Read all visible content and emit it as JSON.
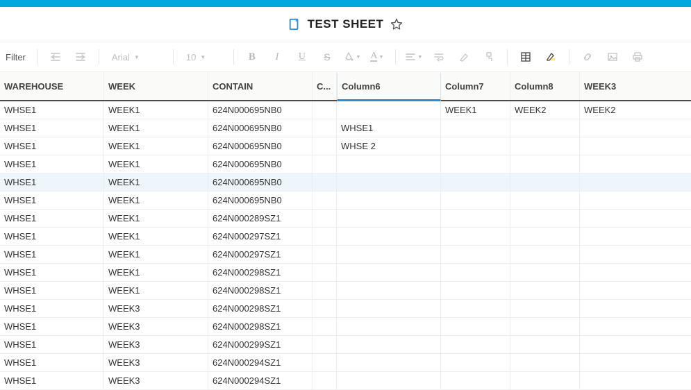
{
  "app": {
    "title": "TEST SHEET"
  },
  "toolbar": {
    "filter": "Filter",
    "font": "Arial",
    "font_size": "10"
  },
  "table": {
    "columns": [
      "WAREHOUSE",
      "WEEK",
      "CONTAIN",
      "C...",
      "Column6",
      "Column7",
      "Column8",
      "WEEK3"
    ],
    "selected_col_index": 4,
    "highlighted_row_index": 4,
    "rows": [
      [
        "WHSE1",
        "WEEK1",
        "624N000695NB0",
        "",
        "",
        "WEEK1",
        "WEEK2",
        "WEEK2"
      ],
      [
        "WHSE1",
        "WEEK1",
        "624N000695NB0",
        "",
        "WHSE1",
        "",
        "",
        ""
      ],
      [
        "WHSE1",
        "WEEK1",
        "624N000695NB0",
        "",
        "WHSE 2",
        "",
        "",
        ""
      ],
      [
        "WHSE1",
        "WEEK1",
        "624N000695NB0",
        "",
        "",
        "",
        "",
        ""
      ],
      [
        "WHSE1",
        "WEEK1",
        "624N000695NB0",
        "",
        "",
        "",
        "",
        ""
      ],
      [
        "WHSE1",
        "WEEK1",
        "624N000695NB0",
        "",
        "",
        "",
        "",
        ""
      ],
      [
        "WHSE1",
        "WEEK1",
        "624N000289SZ1",
        "",
        "",
        "",
        "",
        ""
      ],
      [
        "WHSE1",
        "WEEK1",
        "624N000297SZ1",
        "",
        "",
        "",
        "",
        ""
      ],
      [
        "WHSE1",
        "WEEK1",
        "624N000297SZ1",
        "",
        "",
        "",
        "",
        ""
      ],
      [
        "WHSE1",
        "WEEK1",
        "624N000298SZ1",
        "",
        "",
        "",
        "",
        ""
      ],
      [
        "WHSE1",
        "WEEK1",
        "624N000298SZ1",
        "",
        "",
        "",
        "",
        ""
      ],
      [
        "WHSE1",
        "WEEK3",
        "624N000298SZ1",
        "",
        "",
        "",
        "",
        ""
      ],
      [
        "WHSE1",
        "WEEK3",
        "624N000298SZ1",
        "",
        "",
        "",
        "",
        ""
      ],
      [
        "WHSE1",
        "WEEK3",
        "624N000299SZ1",
        "",
        "",
        "",
        "",
        ""
      ],
      [
        "WHSE1",
        "WEEK3",
        "624N000294SZ1",
        "",
        "",
        "",
        "",
        ""
      ],
      [
        "WHSE1",
        "WEEK3",
        "624N000294SZ1",
        "",
        "",
        "",
        "",
        ""
      ]
    ]
  }
}
